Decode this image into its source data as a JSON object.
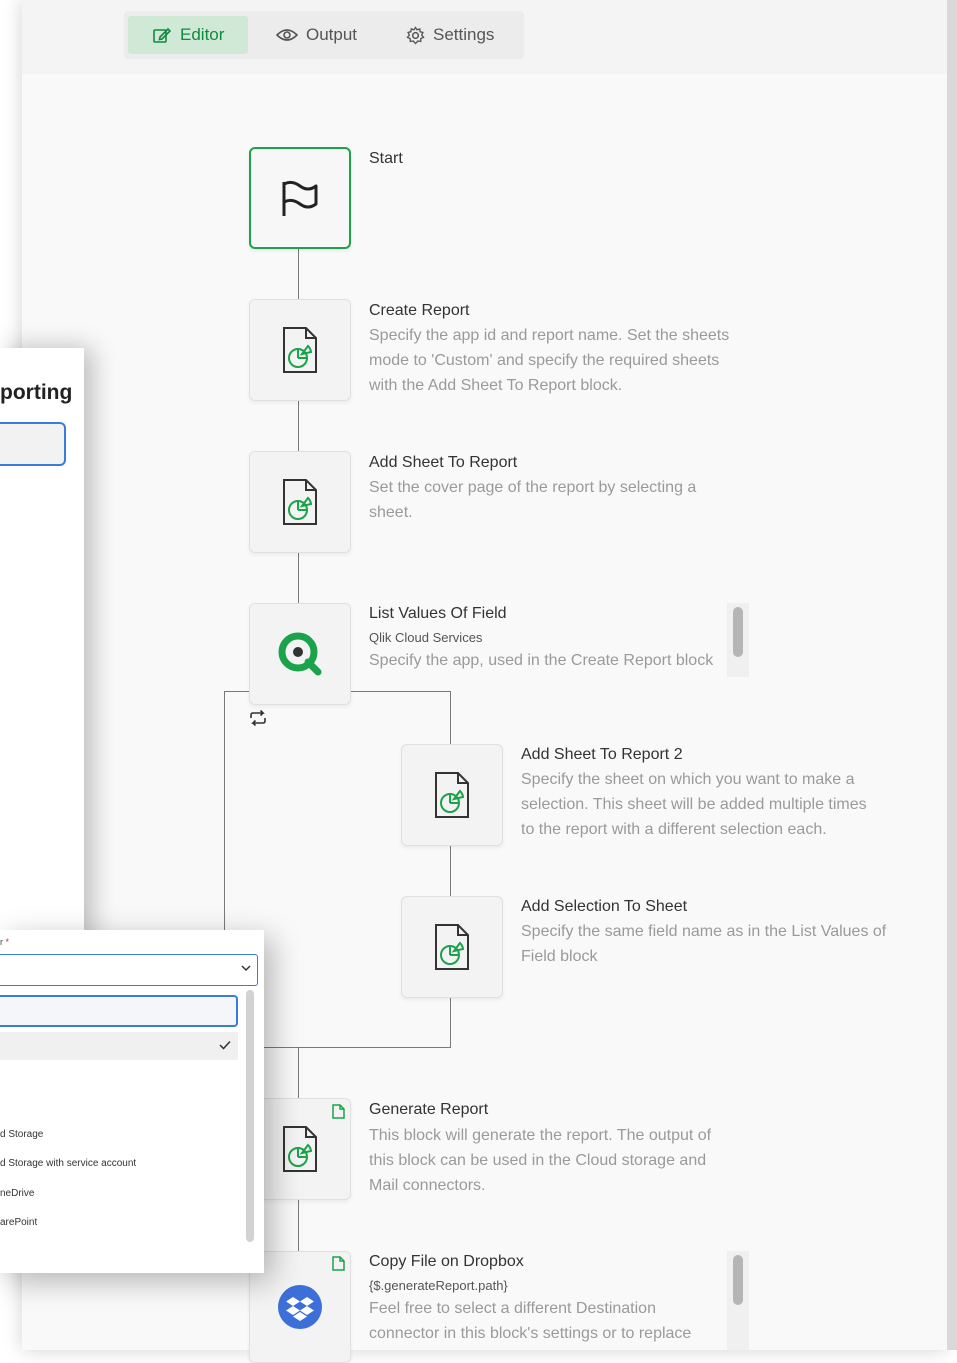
{
  "tabs": {
    "editor": "Editor",
    "output": "Output",
    "settings": "Settings"
  },
  "blocks": {
    "start": {
      "title": "Start"
    },
    "create_report": {
      "title": "Create Report",
      "desc1": "Specify the app id and report name. Set the sheets",
      "desc2": "mode to 'Custom' and specify the required sheets",
      "desc3": "with the Add Sheet To Report block."
    },
    "add_sheet": {
      "title": "Add Sheet To Report",
      "desc1": "Set the cover page of the report by selecting a",
      "desc2": "sheet."
    },
    "list_values": {
      "title": "List Values Of Field",
      "subtitle": "Qlik Cloud Services",
      "desc1": "Specify the app, used in the Create Report block"
    },
    "add_sheet_2": {
      "title": "Add Sheet To Report 2",
      "desc1": "Specify the sheet on which you want to make a",
      "desc2": "selection. This sheet will be added multiple times",
      "desc3": "to the report with a different selection each."
    },
    "add_selection": {
      "title": "Add Selection To Sheet",
      "desc1": "Specify the same field name as in the List Values of",
      "desc2": "Field block"
    },
    "generate_report": {
      "title": "Generate Report",
      "desc1": "This block will generate the report. The output of",
      "desc2": "this block can be used in the Cloud storage and",
      "desc3": "Mail connectors."
    },
    "copy_dropbox": {
      "title": "Copy File on Dropbox",
      "subtitle": "{$.generateReport.path}",
      "desc1": "Feel free to select a different Destination",
      "desc2": "connector in this block's settings or to replace"
    }
  },
  "overlay_panel": {
    "title_fragment": "porting"
  },
  "overlay_dropdown": {
    "label_fragment": "r",
    "required_mark": "*",
    "options": [
      "d Storage",
      "d Storage with service account",
      "neDrive",
      "arePoint"
    ]
  },
  "colors": {
    "accent_green": "#1aa34a",
    "active_tab_bg": "#cfe9d6",
    "focus_blue": "#3a7be0",
    "dropbox_blue": "#3d6fd8"
  }
}
